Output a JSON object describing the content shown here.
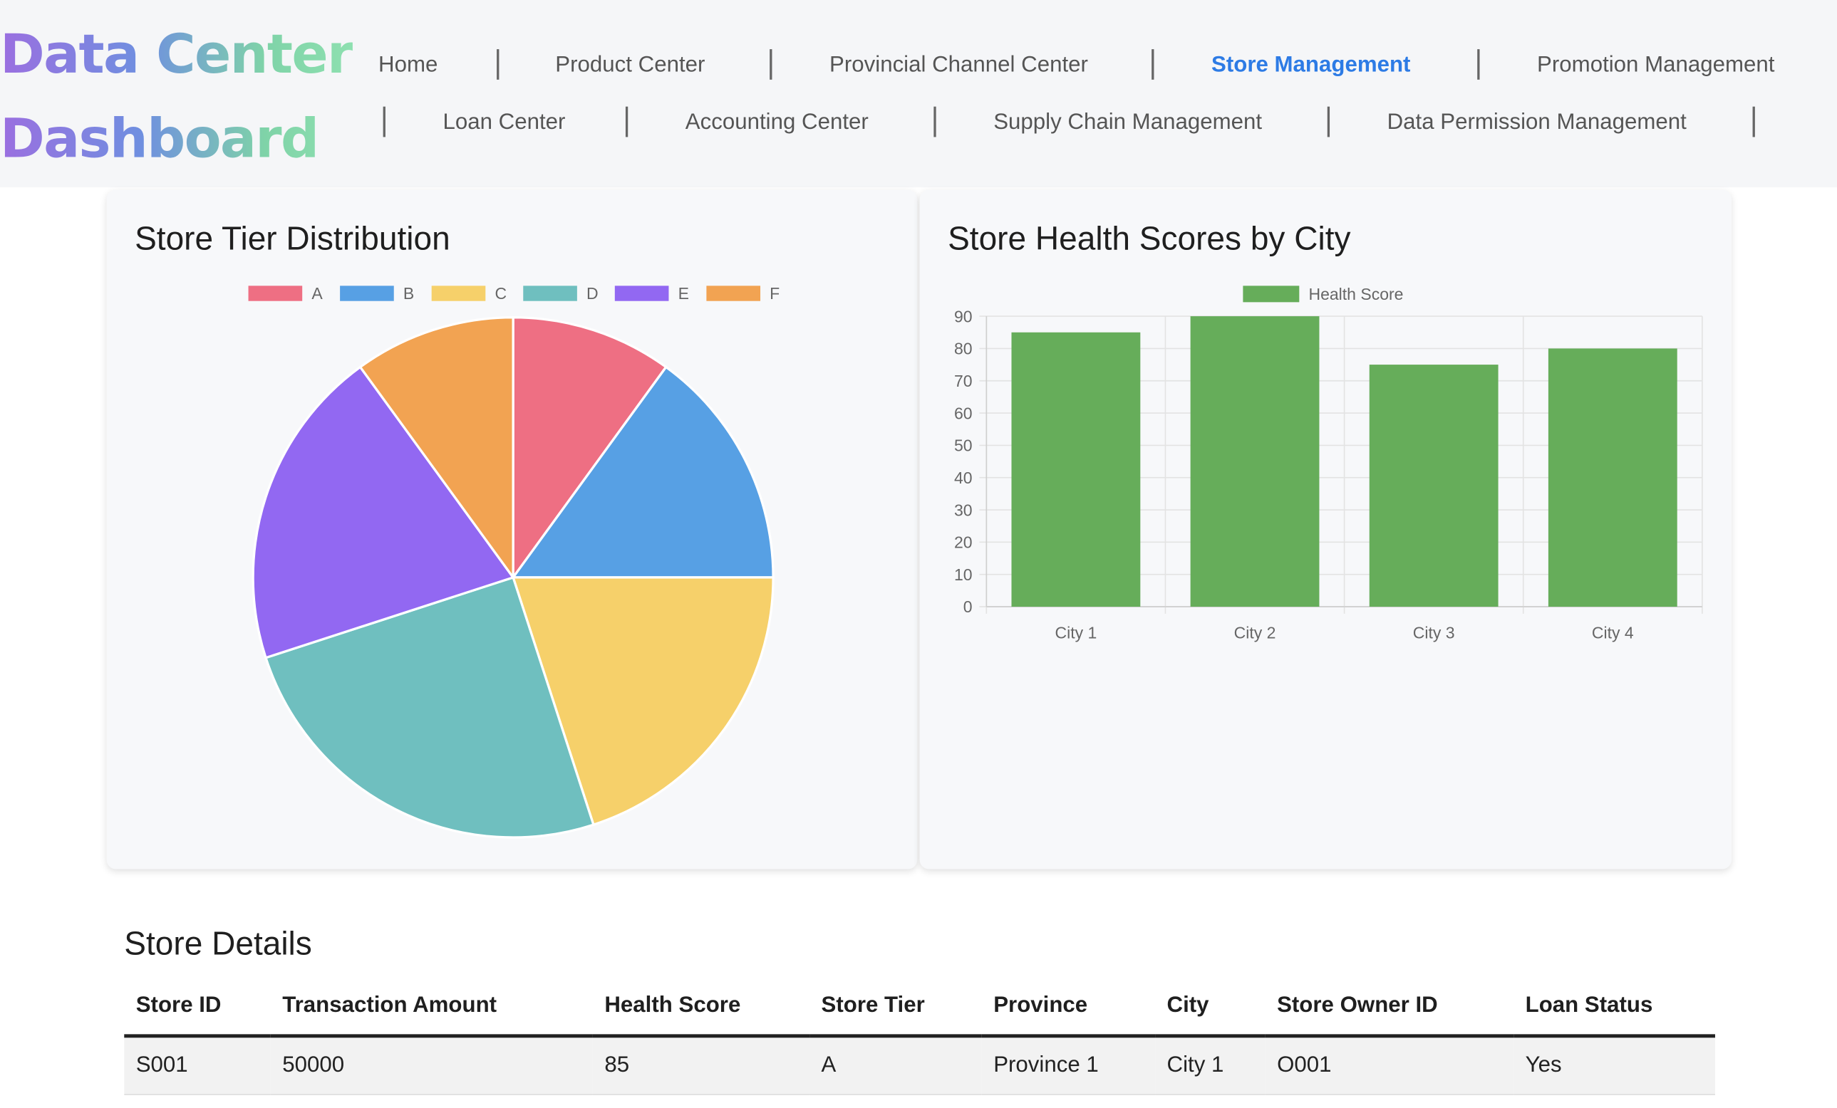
{
  "app": {
    "title_line1": "Data Center",
    "title_line2": "Dashboard"
  },
  "nav": {
    "items": [
      {
        "label": "Home",
        "active": false
      },
      {
        "label": "Product Center",
        "active": false
      },
      {
        "label": "Provincial Channel Center",
        "active": false
      },
      {
        "label": "Store Management",
        "active": true
      },
      {
        "label": "Promotion Management",
        "active": false
      },
      {
        "label": "Loan Center",
        "active": false
      },
      {
        "label": "Accounting Center",
        "active": false
      },
      {
        "label": "Supply Chain Management",
        "active": false
      },
      {
        "label": "Data Permission Management",
        "active": false
      }
    ],
    "active_color": "#2d7be5"
  },
  "pie_card": {
    "title": "Store Tier Distribution"
  },
  "bar_card": {
    "title": "Store Health Scores by City"
  },
  "chart_data": [
    {
      "type": "pie",
      "title": "Store Tier Distribution",
      "legend_position": "top",
      "categories": [
        "A",
        "B",
        "C",
        "D",
        "E",
        "F"
      ],
      "values": [
        10,
        15,
        20,
        25,
        20,
        10
      ],
      "colors": [
        "#ee6f83",
        "#57a0e4",
        "#f6d06a",
        "#6fbfbf",
        "#9268f2",
        "#f2a352"
      ]
    },
    {
      "type": "bar",
      "title": "Store Health Scores by City",
      "legend_position": "top",
      "categories": [
        "City 1",
        "City 2",
        "City 3",
        "City 4"
      ],
      "series": [
        {
          "name": "Health Score",
          "values": [
            85,
            90,
            75,
            80
          ],
          "color": "#66ad5a"
        }
      ],
      "ylim": [
        0,
        90
      ],
      "yticks": [
        0,
        10,
        20,
        30,
        40,
        50,
        60,
        70,
        80,
        90
      ],
      "grid": true
    }
  ],
  "table": {
    "title": "Store Details",
    "headers": [
      "Store ID",
      "Transaction Amount",
      "Health Score",
      "Store Tier",
      "Province",
      "City",
      "Store Owner ID",
      "Loan Status"
    ],
    "rows": [
      [
        "S001",
        "50000",
        "85",
        "A",
        "Province 1",
        "City 1",
        "O001",
        "Yes"
      ]
    ]
  }
}
